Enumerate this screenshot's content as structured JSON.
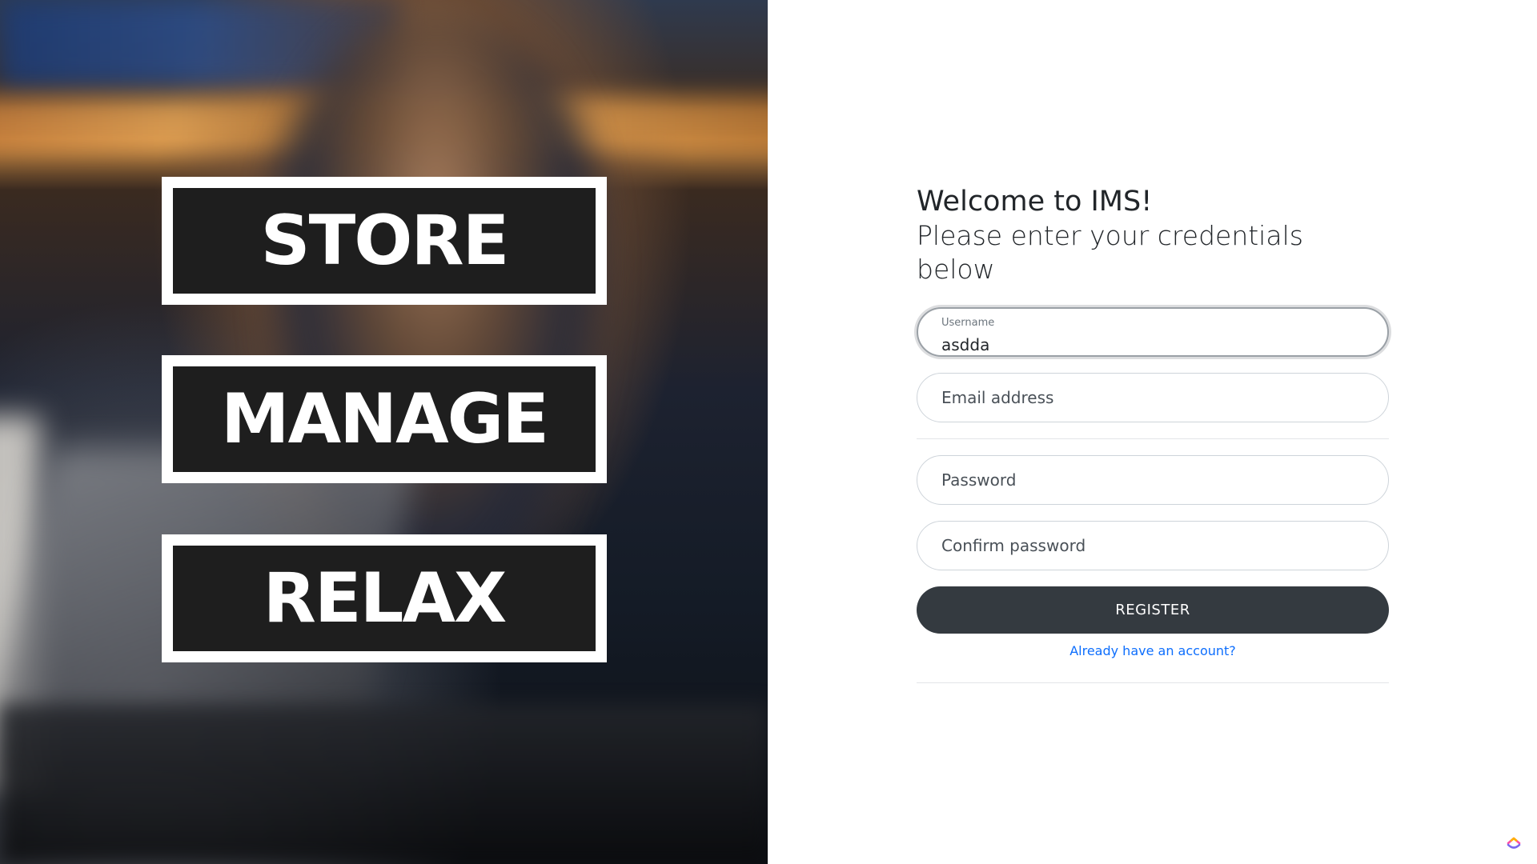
{
  "hero": {
    "words": [
      "STORE",
      "MANAGE",
      "RELAX"
    ]
  },
  "form": {
    "welcome": "Welcome to IMS!",
    "subtitle": "Please enter your credentials below",
    "username": {
      "label": "Username",
      "value": "asdda"
    },
    "email": {
      "placeholder": "Email address"
    },
    "password": {
      "placeholder": "Password"
    },
    "confirm_password": {
      "placeholder": "Confirm password"
    },
    "register_label": "REGISTER",
    "login_link": "Already have an account?"
  },
  "colors": {
    "button_bg": "#343a40",
    "link": "#0d6efd",
    "text": "#212529"
  },
  "icons": {
    "corner": "clickup-icon"
  }
}
